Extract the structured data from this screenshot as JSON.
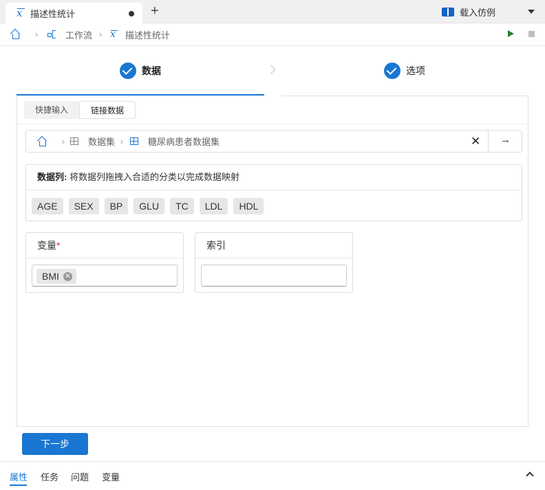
{
  "tab": {
    "title": "描述性统计"
  },
  "breadcrumb": {
    "workflow": "工作流",
    "current": "描述性统计",
    "sep": "›"
  },
  "toolbar": {
    "load_example": "载入仿例"
  },
  "steps": [
    {
      "label": "数据"
    },
    {
      "label": "选项"
    }
  ],
  "subtabs": {
    "quick": "快捷输入",
    "link": "链接数据"
  },
  "path": {
    "sep": "›",
    "dataset": "数据集",
    "selected": "糖尿病患者数据集",
    "clear": "✕",
    "go": "→"
  },
  "columns": {
    "title": "数据列:",
    "hint": " 将数据列拖拽入合适的分类以完成数据映射",
    "items": [
      "AGE",
      "SEX",
      "BP",
      "GLU",
      "TC",
      "LDL",
      "HDL"
    ]
  },
  "variable": {
    "title": "变量",
    "required": "*",
    "tag": "BMI",
    "tag_remove": "✕"
  },
  "index": {
    "title": "索引",
    "value": ""
  },
  "next_button": "下一步",
  "bottom_tabs": [
    "属性",
    "任务",
    "问题",
    "变量"
  ],
  "colors": {
    "accent": "#1976d2",
    "run": "#2e7d32"
  }
}
